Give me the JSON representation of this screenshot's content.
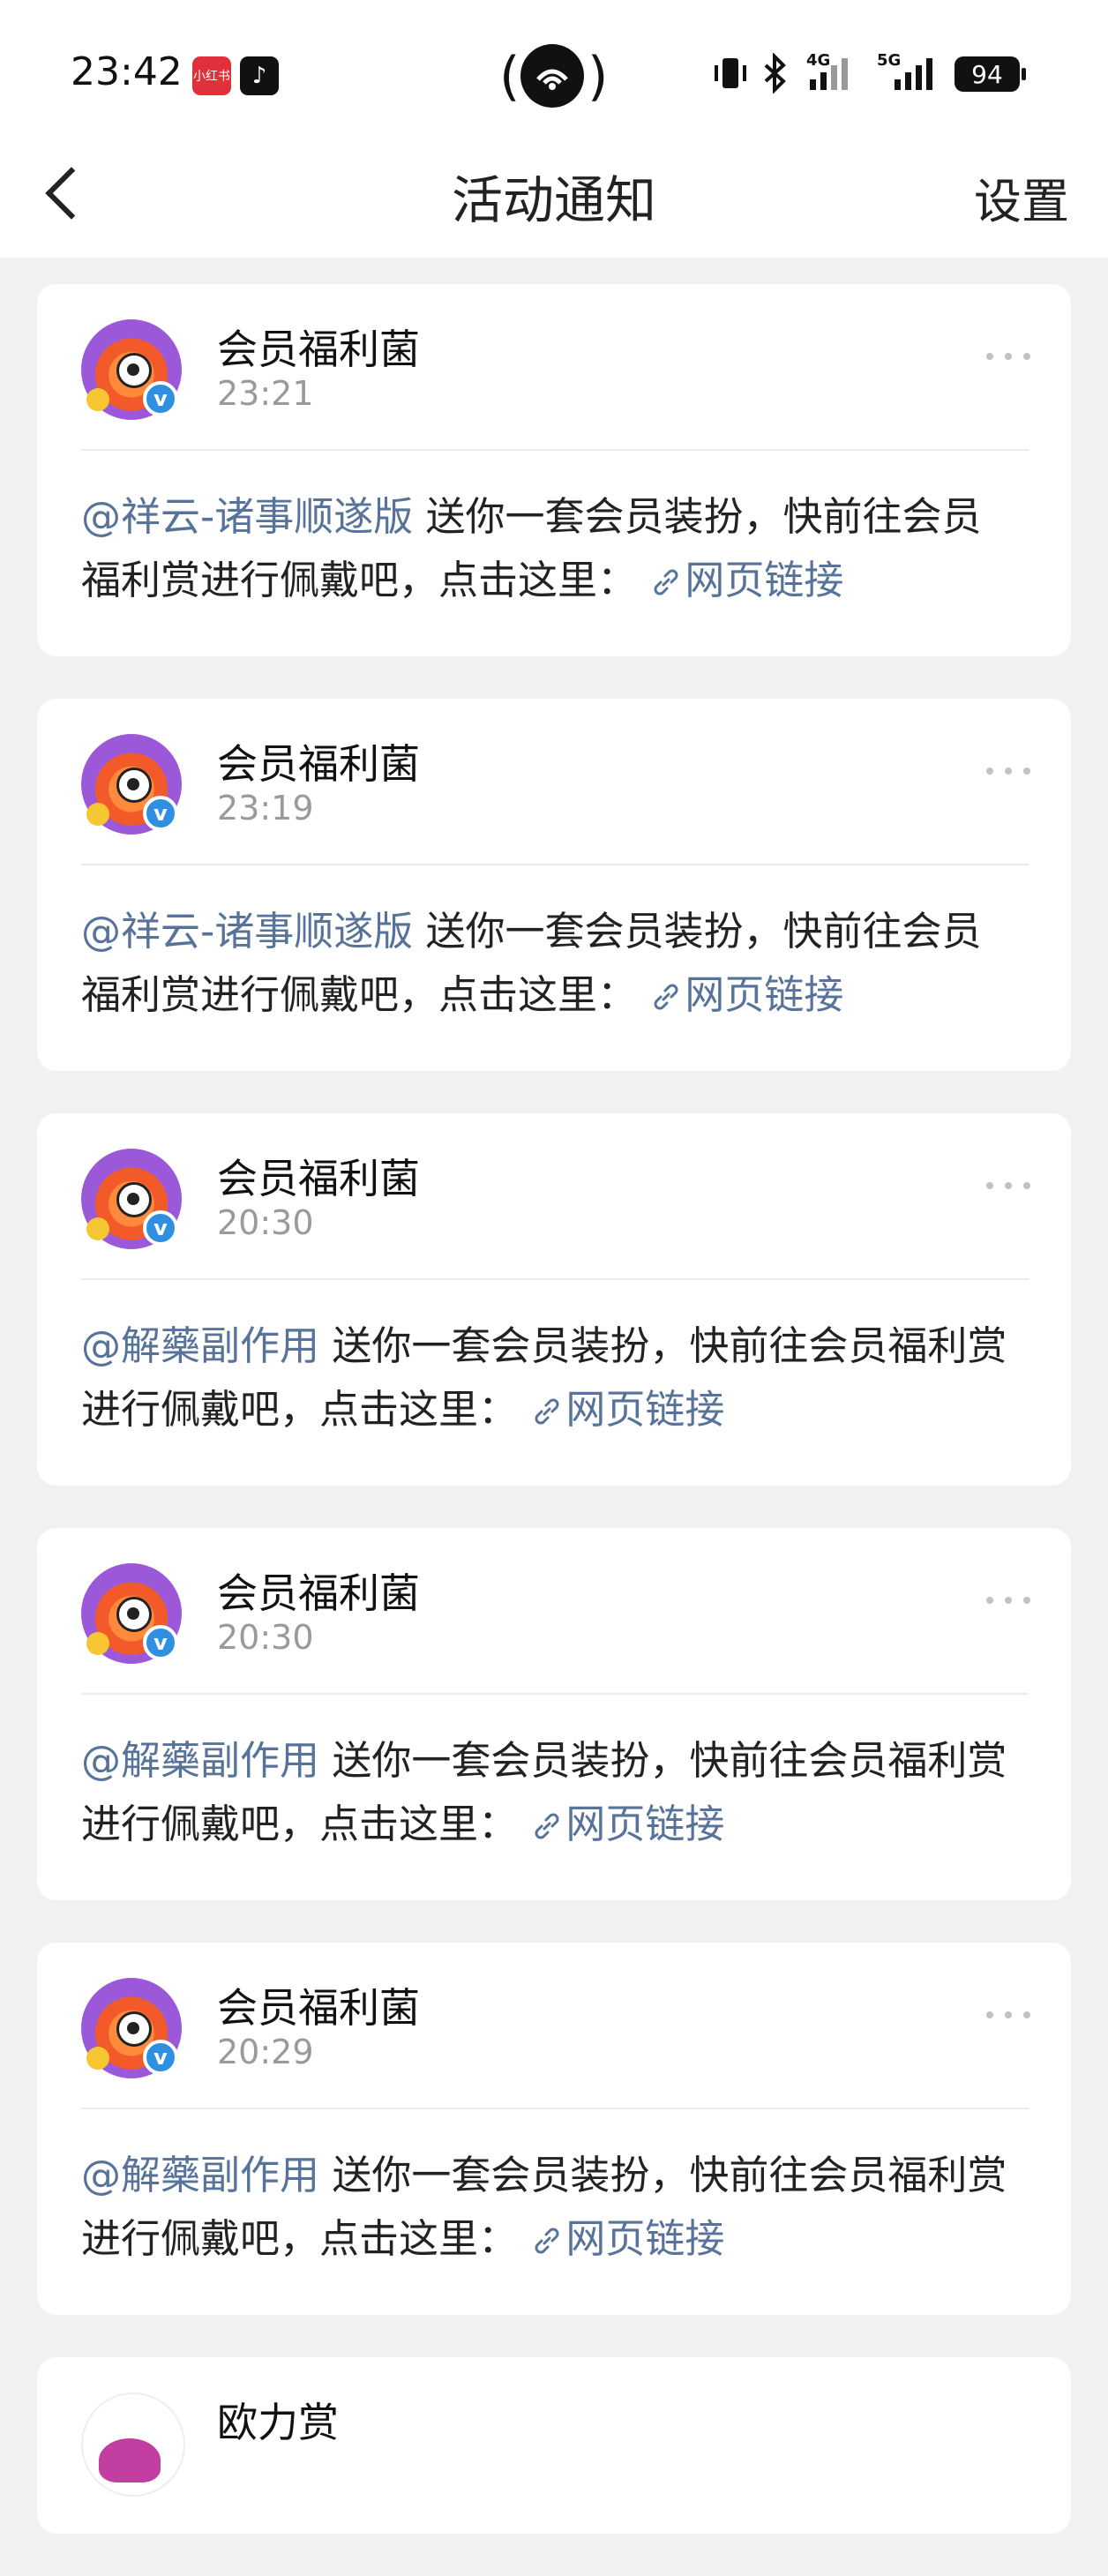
{
  "status_bar": {
    "time": "23:42",
    "xhs_label": "小红书",
    "network1": "4G",
    "network2": "5G",
    "battery": "94"
  },
  "nav": {
    "title": "活动通知",
    "settings": "设置"
  },
  "cards": [
    {
      "name": "会员福利菌",
      "time": "23:21",
      "mention": "@祥云-诸事顺遂版",
      "text": " 送你一套会员装扮，快前往会员福利赏进行佩戴吧，点击这里： ",
      "link": "网页链接"
    },
    {
      "name": "会员福利菌",
      "time": "23:19",
      "mention": "@祥云-诸事顺遂版",
      "text": " 送你一套会员装扮，快前往会员福利赏进行佩戴吧，点击这里： ",
      "link": "网页链接"
    },
    {
      "name": "会员福利菌",
      "time": "20:30",
      "mention": "@解藥副作用",
      "text": " 送你一套会员装扮，快前往会员福利赏进行佩戴吧，点击这里： ",
      "link": "网页链接"
    },
    {
      "name": "会员福利菌",
      "time": "20:30",
      "mention": "@解藥副作用",
      "text": " 送你一套会员装扮，快前往会员福利赏进行佩戴吧，点击这里： ",
      "link": "网页链接"
    },
    {
      "name": "会员福利菌",
      "time": "20:29",
      "mention": "@解藥副作用",
      "text": " 送你一套会员装扮，快前往会员福利赏进行佩戴吧，点击这里： ",
      "link": "网页链接"
    }
  ],
  "partial_card": {
    "name": "欧力赏"
  }
}
